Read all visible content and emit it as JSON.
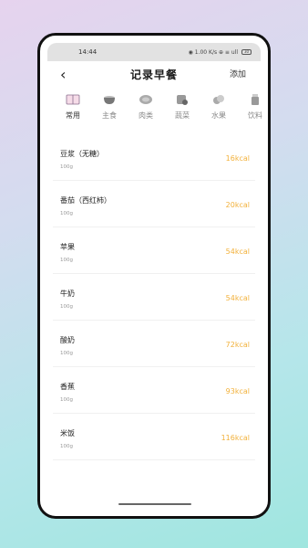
{
  "status": {
    "time": "14:44",
    "icons_text": "◉ 1.00 K/s ⊕ ≡ ull",
    "battery": "30"
  },
  "header": {
    "title": "记录早餐",
    "back_icon": "‹",
    "action_label": "添加"
  },
  "categories": [
    {
      "label": "常用",
      "icon": "book-icon",
      "active": true
    },
    {
      "label": "主食",
      "icon": "rice-pot-icon"
    },
    {
      "label": "肉类",
      "icon": "meat-icon"
    },
    {
      "label": "蔬菜",
      "icon": "vegetable-icon"
    },
    {
      "label": "水果",
      "icon": "fruit-icon"
    },
    {
      "label": "饮料",
      "icon": "drink-icon"
    }
  ],
  "foods": [
    {
      "name": "豆浆（无糖）",
      "qty": "100g",
      "kcal": "16kcal"
    },
    {
      "name": "番茄（西红柿）",
      "qty": "100g",
      "kcal": "20kcal"
    },
    {
      "name": "苹果",
      "qty": "100g",
      "kcal": "54kcal"
    },
    {
      "name": "牛奶",
      "qty": "100g",
      "kcal": "54kcal"
    },
    {
      "name": "酸奶",
      "qty": "100g",
      "kcal": "72kcal"
    },
    {
      "name": "香蕉",
      "qty": "100g",
      "kcal": "93kcal"
    },
    {
      "name": "米饭",
      "qty": "100g",
      "kcal": "116kcal"
    }
  ],
  "colors": {
    "kcal": "#f2b13b",
    "background_top": "#e6d3ee",
    "background_bottom": "#9fe6df"
  }
}
